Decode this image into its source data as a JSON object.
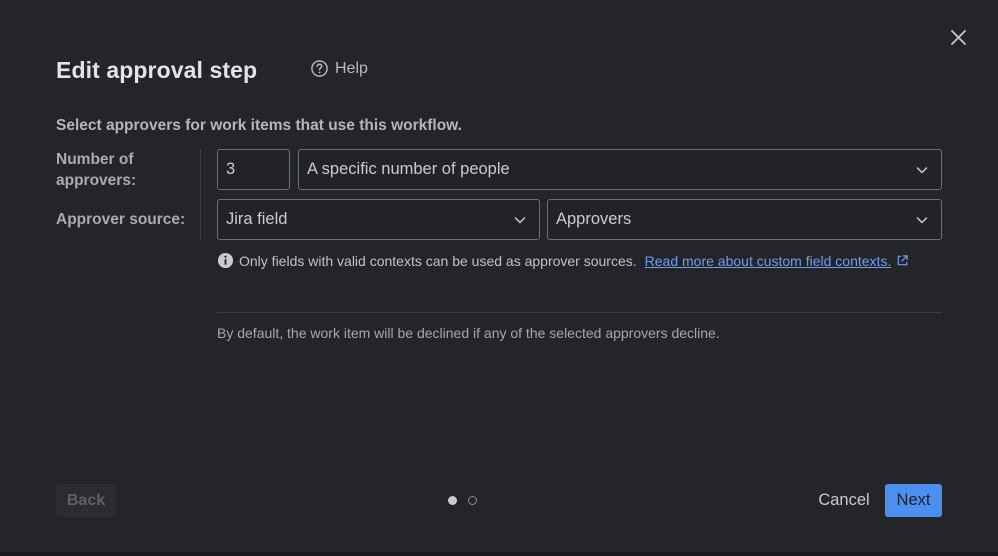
{
  "dialog": {
    "title": "Edit approval step",
    "help_label": "Help",
    "description": "Select approvers for work items that use this workflow."
  },
  "approvers": {
    "number_label": "Number of approvers:",
    "number_value": "3",
    "mode_value": "A specific number of people",
    "source_label": "Approver source:",
    "source_type_value": "Jira field",
    "source_field_value": "Approvers"
  },
  "info": {
    "text": "Only fields with valid contexts can be used as approver sources.",
    "link_text": "Read more about custom field contexts."
  },
  "note": "By default, the work item will be declined if any of the selected approvers decline.",
  "footer": {
    "back_label": "Back",
    "cancel_label": "Cancel",
    "next_label": "Next",
    "step_current": 1,
    "step_total": 2
  },
  "colors": {
    "primary": "#4d8ff0",
    "link": "#6f9df0",
    "background": "#242528"
  }
}
